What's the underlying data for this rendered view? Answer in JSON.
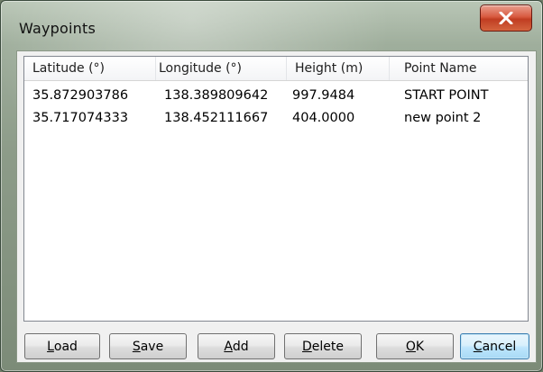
{
  "window": {
    "title": "Waypoints",
    "close_label": "X"
  },
  "list": {
    "columns": [
      "Latitude (°)",
      "Longitude (°)",
      "Height (m)",
      "Point Name"
    ],
    "rows": [
      [
        "35.872903786",
        "138.389809642",
        "997.9484",
        "START POINT"
      ],
      [
        "35.717074333",
        "138.452111667",
        "404.0000",
        "new point 2"
      ]
    ]
  },
  "buttons": {
    "load": {
      "mnemonic": "L",
      "rest": "oad"
    },
    "save": {
      "mnemonic": "S",
      "rest": "ave"
    },
    "add": {
      "mnemonic": "A",
      "rest": "dd"
    },
    "delete": {
      "mnemonic": "D",
      "rest": "elete"
    },
    "ok": {
      "mnemonic": "O",
      "rest": "K"
    },
    "cancel": {
      "mnemonic": "C",
      "rest": "ancel"
    }
  },
  "colors": {
    "close_button": "#c84a2c",
    "focus_border": "#3c7fb1"
  }
}
